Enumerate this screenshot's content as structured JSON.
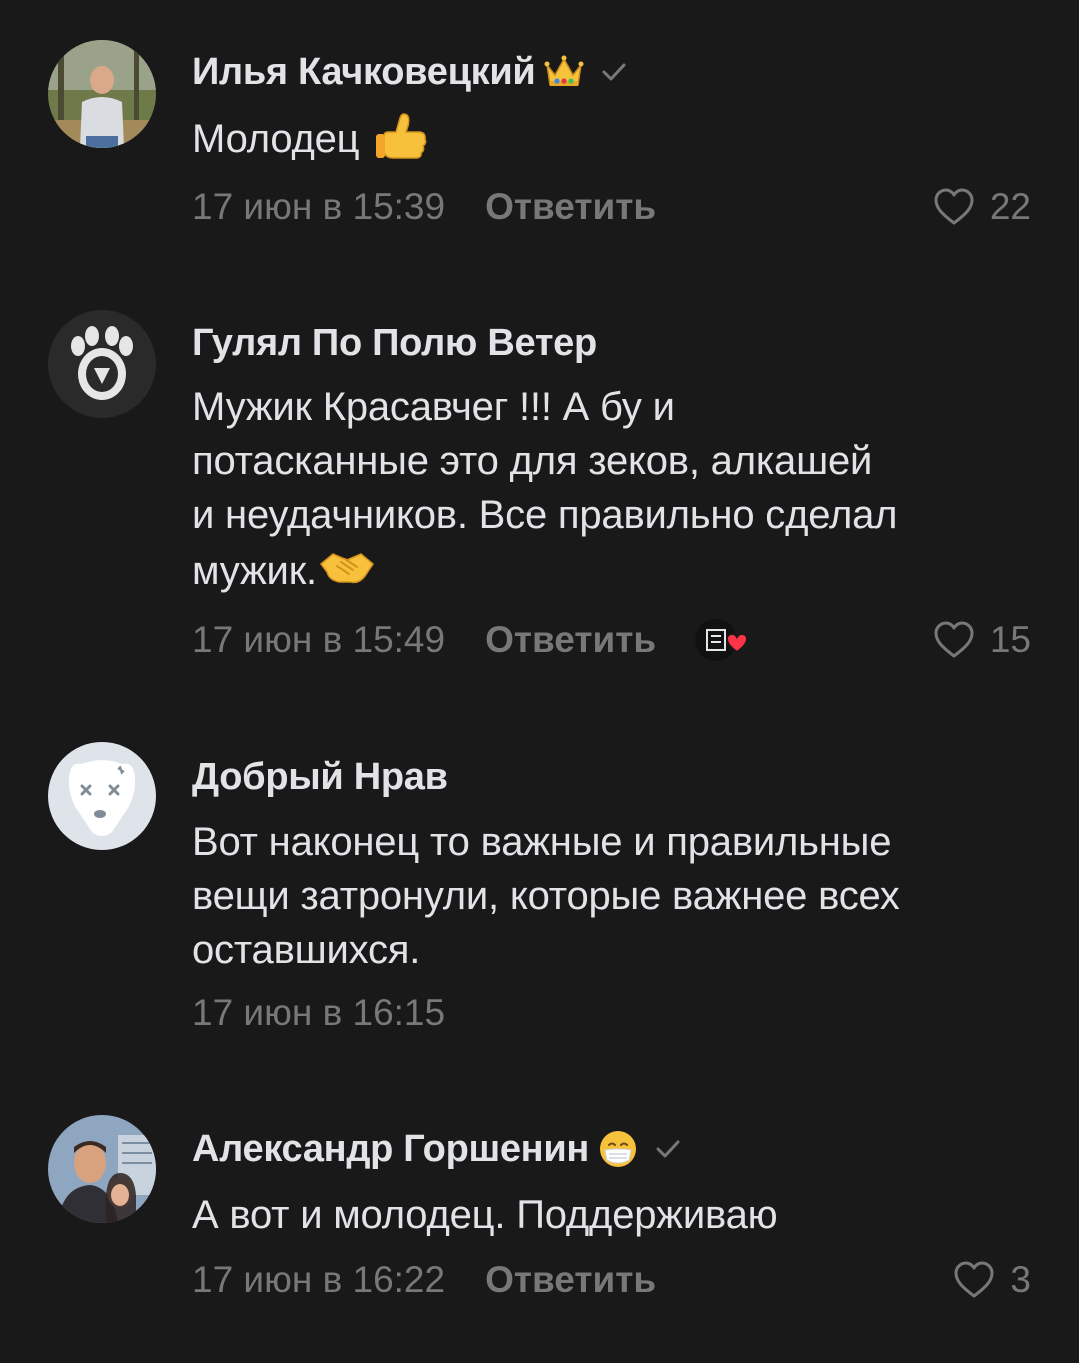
{
  "comments": [
    {
      "author": "Илья Качковецкий",
      "badge_icon": "crown-icon",
      "verified": true,
      "text": "Молодец",
      "text_emoji": "thumbs-up-icon",
      "date": "17 июн в 15:39",
      "reply_label": "Ответить",
      "likes": "22"
    },
    {
      "author": "Гулял По Полю Ветер",
      "verified": false,
      "text_lines": [
        "Мужик Красавчег !!! А бу и",
        "потасканные это для зеков, алкашей",
        "и неудачников. Все правильно сделал",
        "мужик."
      ],
      "text_emoji": "handshake-icon",
      "date": "17 июн в 15:49",
      "reply_label": "Ответить",
      "author_liked": true,
      "likes": "15"
    },
    {
      "author": "Добрый Нрав",
      "verified": false,
      "text_lines": [
        "Вот наконец то важные и правильные",
        "вещи затронули, которые важнее всех",
        "оставшихся."
      ],
      "date": "17 июн в 16:15"
    },
    {
      "author": "Александр Горшенин",
      "badge_icon": "mask-face-icon",
      "verified": true,
      "text": "А вот и молодец. Поддерживаю",
      "date": "17 июн в 16:22",
      "reply_label": "Ответить",
      "likes": "3"
    }
  ],
  "colors": {
    "background": "#19191a",
    "text": "#e1e3e6",
    "secondary": "#76787a",
    "heart_red": "#ff3347"
  }
}
